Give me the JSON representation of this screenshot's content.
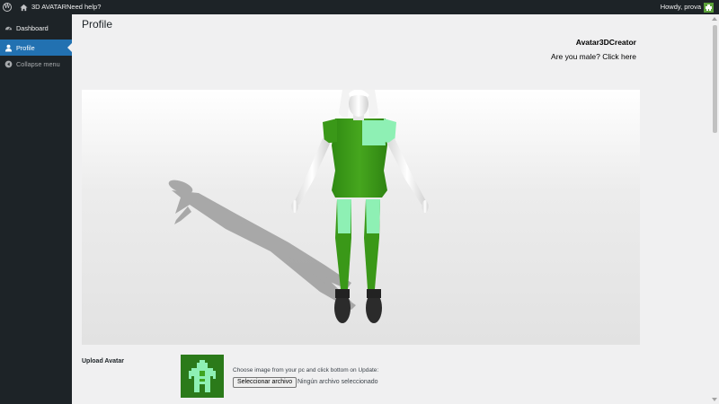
{
  "admin_bar": {
    "site_name": "3D AVATAR",
    "help": "Need help?",
    "greeting": "Howdy, prova"
  },
  "sidebar": {
    "items": [
      {
        "label": "Dashboard",
        "icon": "dashboard-icon"
      },
      {
        "label": "Profile",
        "icon": "user-icon",
        "active": true
      },
      {
        "label": "Collapse menu",
        "icon": "collapse-icon"
      }
    ]
  },
  "main": {
    "title": "Profile",
    "creator_title": "Avatar3DCreator",
    "gender_link": "Are you male? Click here"
  },
  "upload": {
    "label": "Upload Avatar",
    "hint": "Choose image from your pc and click bottom on Update:",
    "button": "Seleccionar archivo",
    "status": "Ningún archivo seleccionado"
  },
  "colors": {
    "admin_bg": "#1d2327",
    "accent": "#2271b1",
    "shirt_green": "#3d9a1a",
    "shirt_light": "#8ef0b4"
  }
}
